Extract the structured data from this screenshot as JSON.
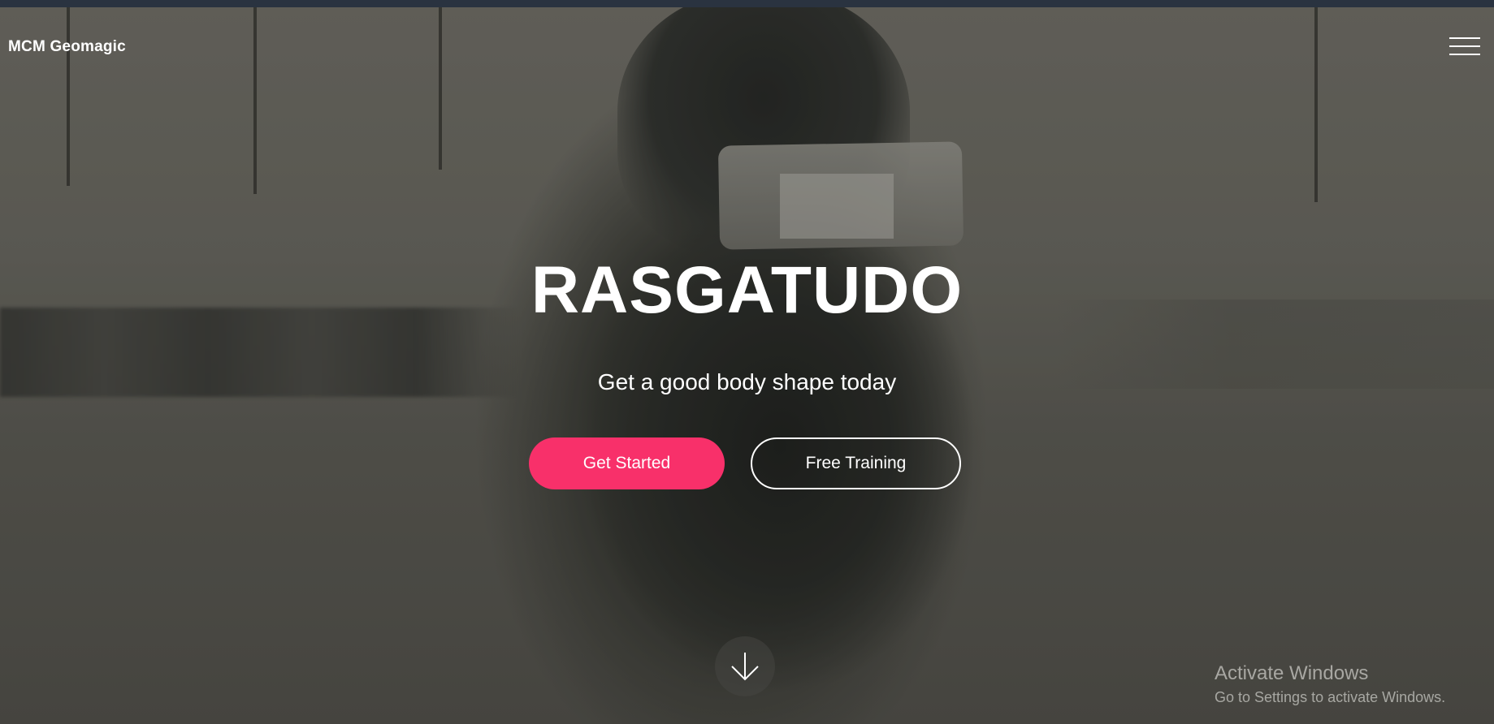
{
  "header": {
    "brand": "MCM Geomagic",
    "menu_icon": "hamburger-menu-icon"
  },
  "hero": {
    "title": "RASGATUDO",
    "subtitle": "Get a good body shape today",
    "primary_button": "Get Started",
    "secondary_button": "Free Training",
    "scroll_icon": "arrow-down-icon"
  },
  "watermark": {
    "title": "Activate Windows",
    "subtitle": "Go to Settings to activate Windows."
  },
  "colors": {
    "accent": "#f8306a",
    "text": "#ffffff",
    "topbar": "#2a3340"
  }
}
